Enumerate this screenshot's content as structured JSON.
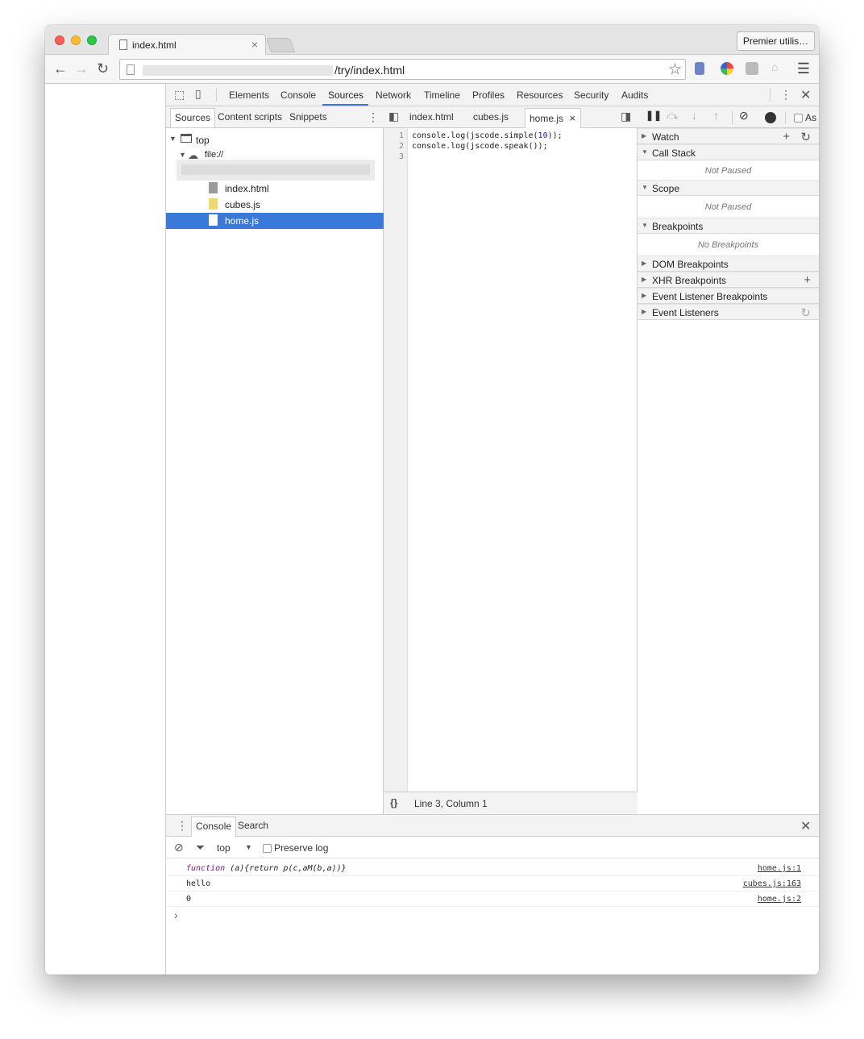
{
  "browser": {
    "tab_title": "index.html",
    "tab_close": "×",
    "profile_button": "Premier utilis…",
    "url": "/try/index.html"
  },
  "devtools": {
    "main_tabs": [
      "Elements",
      "Console",
      "Sources",
      "Network",
      "Timeline",
      "Profiles",
      "Resources",
      "Security",
      "Audits"
    ],
    "active_tab": "Sources",
    "navigator": {
      "tabs": [
        "Sources",
        "Content scripts",
        "Snippets"
      ],
      "tree": {
        "top": "top",
        "origin": "file://",
        "files": [
          "index.html",
          "cubes.js",
          "home.js"
        ],
        "selected": "home.js"
      }
    },
    "editor": {
      "tabs": [
        "index.html",
        "cubes.js",
        "home.js"
      ],
      "active_tab": "home.js",
      "line_numbers": [
        "1",
        "2",
        "3"
      ],
      "lines": [
        {
          "pre": "console.log(jscode.simple(",
          "num": "10",
          "post": "));"
        },
        {
          "pre": "console.log(jscode.speak());",
          "num": "",
          "post": ""
        },
        {
          "pre": "",
          "num": "",
          "post": ""
        }
      ],
      "format_button": "{}",
      "cursor_status": "Line 3, Column 1"
    },
    "debugger": {
      "async_label": "As",
      "watch": "Watch",
      "call_stack": "Call Stack",
      "call_stack_status": "Not Paused",
      "scope": "Scope",
      "scope_status": "Not Paused",
      "breakpoints": "Breakpoints",
      "breakpoints_status": "No Breakpoints",
      "dom_breakpoints": "DOM Breakpoints",
      "xhr_breakpoints": "XHR Breakpoints",
      "event_listener_breakpoints": "Event Listener Breakpoints",
      "event_listeners": "Event Listeners"
    },
    "drawer": {
      "tabs": [
        "Console",
        "Search"
      ],
      "context": "top",
      "preserve_log": "Preserve log",
      "messages": [
        {
          "keyword": "function",
          "text": " (a){return p(c,aM(b,a))}",
          "source": "home.js:1"
        },
        {
          "keyword": "",
          "text": "hello",
          "source": "cubes.js:163"
        },
        {
          "keyword": "",
          "text": "0",
          "source": "home.js:2"
        }
      ],
      "prompt": "›"
    }
  },
  "colors": {
    "accent": "#3879d9",
    "number": "#1a1aa6",
    "keyword": "#881280"
  }
}
